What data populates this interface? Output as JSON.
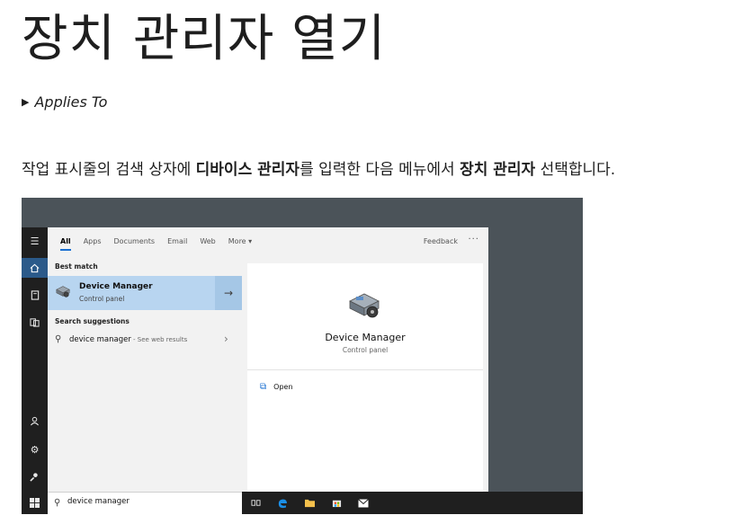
{
  "page": {
    "title": "장치 관리자 열기",
    "applies_to": "Applies To",
    "instruction": {
      "p1": "작업 표시줄의 검색 상자에 ",
      "b1": "디바이스 관리자",
      "p2": "를 입력한 다음 메뉴에서 ",
      "b2": "장치 관리자",
      "p3": " 선택합니다."
    }
  },
  "search_window": {
    "tabs": [
      "All",
      "Apps",
      "Documents",
      "Email",
      "Web",
      "More ▾"
    ],
    "feedback": "Feedback",
    "more_dots": "···",
    "best_match_label": "Best match",
    "best_match": {
      "name": "Device Manager",
      "subtitle": "Control panel"
    },
    "suggestions_label": "Search suggestions",
    "suggestion": {
      "query": "device manager",
      "hint": " - See web results"
    },
    "preview": {
      "name": "Device Manager",
      "subtitle": "Control panel",
      "open_label": "Open"
    },
    "search_value": "device manager",
    "icons": {
      "rail": [
        "hamburger-icon",
        "home-icon",
        "notebook-icon",
        "documents-icon",
        "person-icon",
        "gear-icon",
        "feedback-icon"
      ],
      "taskbar": [
        "task-view-icon",
        "edge-icon",
        "folder-icon",
        "store-icon",
        "mail-icon"
      ]
    },
    "colors": {
      "highlight": "#b8d5f0",
      "accent": "#1a6fd1",
      "rail_active": "#2b5a8a",
      "backdrop": "#4b5359"
    }
  }
}
